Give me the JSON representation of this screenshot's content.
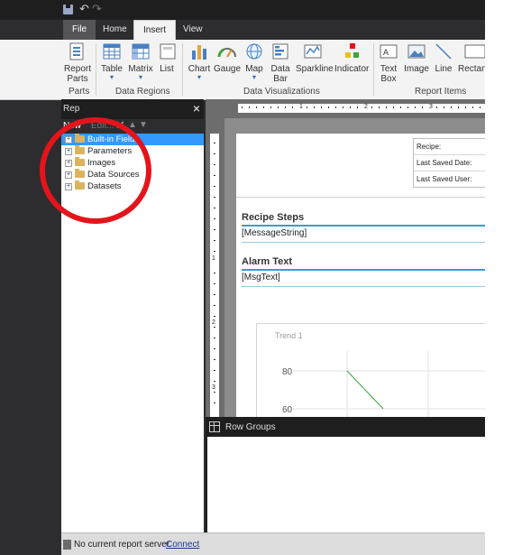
{
  "ribbon": {
    "tabs": {
      "file": "File",
      "home": "Home",
      "insert": "Insert",
      "view": "View"
    },
    "groups": {
      "parts": "Parts",
      "data_regions": "Data Regions",
      "data_visualizations": "Data Visualizations",
      "report_items": "Report Items"
    },
    "buttons": {
      "report_parts": "Report\nParts",
      "table": "Table",
      "matrix": "Matrix",
      "list": "List",
      "chart": "Chart",
      "gauge": "Gauge",
      "map": "Map",
      "data_bar": "Data\nBar",
      "sparkline": "Sparkline",
      "indicator": "Indicator",
      "text_box": "Text\nBox",
      "image": "Image",
      "line": "Line",
      "rectangle": "Rectanc"
    }
  },
  "report_data": {
    "title": "Rep",
    "new_label": "New",
    "edit_label": "Edit...",
    "items": [
      {
        "label": "Built-in Fields",
        "selected": true
      },
      {
        "label": "Parameters",
        "selected": false
      },
      {
        "label": "Images",
        "selected": false
      },
      {
        "label": "Data Sources",
        "selected": false
      },
      {
        "label": "Datasets",
        "selected": false
      }
    ]
  },
  "ruler": {
    "marks": [
      "1",
      "2",
      "3"
    ],
    "vertical_marks": [
      "1",
      "2",
      "3"
    ]
  },
  "report": {
    "header_labels": [
      "Recipe:",
      "Last Saved Date:",
      "Last Saved User:"
    ],
    "recipe_steps_title": "Recipe Steps",
    "recipe_steps_value": "[MessageString]",
    "alarm_text_title": "Alarm Text",
    "alarm_text_value": "[MsgText]"
  },
  "chart_data": {
    "type": "line",
    "title": "Trend 1",
    "y_ticks": [
      80,
      60
    ],
    "series": [
      {
        "color": "#3aa53a",
        "points": [
          [
            1,
            80
          ],
          [
            2,
            60
          ]
        ]
      }
    ]
  },
  "row_groups": {
    "label": "Row Groups"
  },
  "status": {
    "text": "No current report server.",
    "link": "Connect"
  },
  "colors": {
    "annotation_circle": "#e4141a",
    "selection": "#3399ff",
    "accent_line": "#3b9bd0"
  }
}
